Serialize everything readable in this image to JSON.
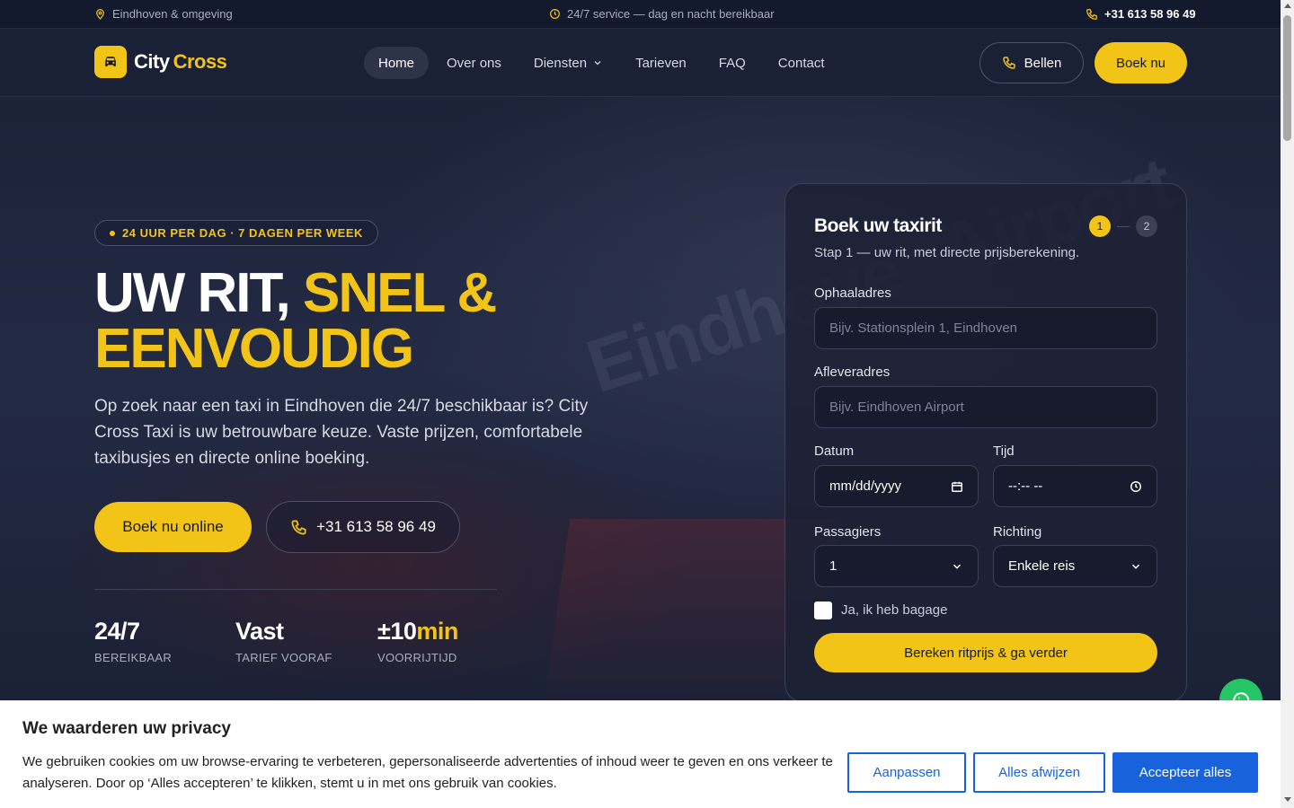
{
  "topbar": {
    "location": "Eindhoven & omgeving",
    "service": "24/7 service — dag en nacht bereikbaar",
    "phone": "+31 613 58 96 49"
  },
  "header": {
    "logo_part1": "City",
    "logo_part2": "Cross",
    "nav": [
      "Home",
      "Over ons",
      "Diensten",
      "Tarieven",
      "FAQ",
      "Contact"
    ],
    "active_nav": "Home",
    "call_label": "Bellen",
    "book_label": "Boek nu"
  },
  "hero": {
    "badge": "24 UUR PER DAG · 7 DAGEN PER WEEK",
    "title_white": "UW RIT,",
    "title_yellow_1": "SNEL &",
    "title_yellow_2": "EENVOUDIG",
    "background_text": "EindhovenAirport",
    "lead": "Op zoek naar een taxi in Eindhoven die 24/7 beschikbaar is? City Cross Taxi is uw betrouwbare keuze. Vaste prijzen, comfortabele taxibusjes en directe online boeking.",
    "cta_primary": "Boek nu online",
    "cta_phone": "+31 613 58 96 49",
    "stats": [
      {
        "value": "24/7",
        "accent": "",
        "label": "BEREIKBAAR"
      },
      {
        "value": "Vast",
        "accent": "",
        "label": "TARIEF VOORAF"
      },
      {
        "value": "±10",
        "accent": "min",
        "label": "VOORRIJTIJD"
      }
    ]
  },
  "booking": {
    "title": "Boek uw taxirit",
    "subtitle": "Stap 1 — uw rit, met directe prijsberekening.",
    "step1": "1",
    "step2": "2",
    "pickup_label": "Ophaaladres",
    "pickup_placeholder": "Bijv. Stationsplein 1, Eindhoven",
    "dropoff_label": "Afleveradres",
    "dropoff_placeholder": "Bijv. Eindhoven Airport",
    "date_label": "Datum",
    "date_placeholder": "mm/dd/yyyy",
    "time_label": "Tijd",
    "time_placeholder": "--:-- --",
    "passengers_label": "Passagiers",
    "passengers_value": "1",
    "direction_label": "Richting",
    "direction_value": "Enkele reis",
    "luggage_label": "Ja, ik heb bagage",
    "submit": "Bereken ritprijs & ga verder"
  },
  "cookie": {
    "title": "We waarderen uw privacy",
    "text": "We gebruiken cookies om uw browse-ervaring te verbeteren, gepersonaliseerde advertenties of inhoud weer te geven en ons verkeer te analyseren. Door op ‘Alles accepteren’ te klikken, stemt u in met ons gebruik van cookies.",
    "customize": "Aanpassen",
    "reject": "Alles afwijzen",
    "accept": "Accepteer alles"
  },
  "colors": {
    "accent": "#f2c418",
    "background": "#141a2e",
    "cookie_blue": "#1863dc",
    "whatsapp": "#25c464"
  },
  "icons": {
    "location": "map-pin-icon",
    "clock": "clock-icon",
    "phone": "phone-icon",
    "car": "car-icon",
    "chevron": "chevron-down-icon",
    "calendar": "calendar-icon",
    "whatsapp": "whatsapp-icon"
  }
}
